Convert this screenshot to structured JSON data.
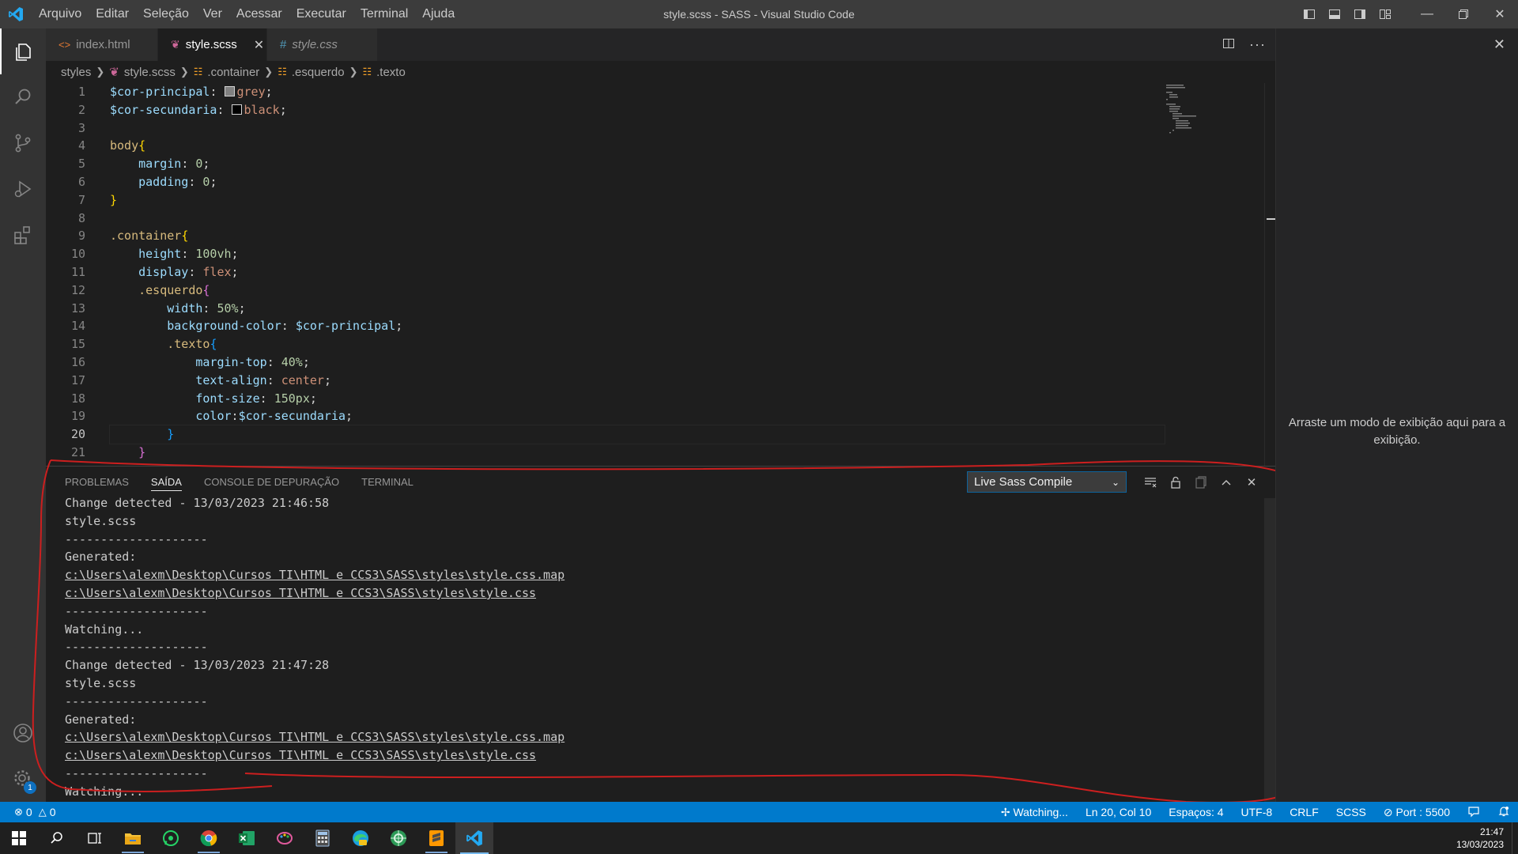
{
  "window": {
    "title": "style.scss - SASS - Visual Studio Code",
    "menu": [
      "Arquivo",
      "Editar",
      "Seleção",
      "Ver",
      "Acessar",
      "Executar",
      "Terminal",
      "Ajuda"
    ]
  },
  "tabs": [
    {
      "label": "index.html",
      "icon": "html-icon"
    },
    {
      "label": "style.scss",
      "icon": "sass-icon",
      "active": true
    },
    {
      "label": "style.css",
      "icon": "css-hash-icon",
      "italic": true
    }
  ],
  "breadcrumb": [
    "styles",
    "style.scss",
    ".container",
    ".esquerdo",
    ".texto"
  ],
  "editor": {
    "current_line": 20,
    "line_numbers": [
      "1",
      "2",
      "3",
      "4",
      "5",
      "6",
      "7",
      "8",
      "9",
      "10",
      "11",
      "12",
      "13",
      "14",
      "15",
      "16",
      "17",
      "18",
      "19",
      "20",
      "21"
    ],
    "lines": {
      "l1": {
        "var": "$cor-principal",
        "colon": ":",
        "val": "grey",
        "semi": ";",
        "swatch_color": "#808080"
      },
      "l2": {
        "var": "$cor-secundaria",
        "colon": ":",
        "val": "black",
        "semi": ";",
        "swatch_color": "#000000"
      },
      "l4": {
        "sel": "body",
        "brace": "{"
      },
      "l5": {
        "prop": "margin",
        "colon": ": ",
        "num": "0",
        "semi": ";"
      },
      "l6": {
        "prop": "padding",
        "colon": ": ",
        "num": "0",
        "semi": ";"
      },
      "l7": {
        "brace": "}"
      },
      "l9": {
        "sel": ".container",
        "brace": "{"
      },
      "l10": {
        "prop": "height",
        "colon": ": ",
        "num": "100vh",
        "semi": ";"
      },
      "l11": {
        "prop": "display",
        "colon": ": ",
        "val": "flex",
        "semi": ";"
      },
      "l12": {
        "sel": ".esquerdo",
        "brace": "{"
      },
      "l13": {
        "prop": "width",
        "colon": ": ",
        "num": "50%",
        "semi": ";"
      },
      "l14": {
        "prop": "background-color",
        "colon": ": ",
        "var": "$cor-principal",
        "semi": ";"
      },
      "l15": {
        "sel": ".texto",
        "brace": "{"
      },
      "l16": {
        "prop": "margin-top",
        "colon": ": ",
        "num": "40%",
        "semi": ";"
      },
      "l17": {
        "prop": "text-align",
        "colon": ": ",
        "val": "center",
        "semi": ";"
      },
      "l18": {
        "prop": "font-size",
        "colon": ": ",
        "num": "150px",
        "semi": ";"
      },
      "l19": {
        "prop": "color",
        "colon": ":",
        "var": "$cor-secundaria",
        "semi": ";"
      },
      "l20": {
        "brace": "}"
      },
      "l21": {
        "brace": "}"
      }
    }
  },
  "panel": {
    "tabs": [
      "PROBLEMAS",
      "SAÍDA",
      "CONSOLE DE DEPURAÇÃO",
      "TERMINAL"
    ],
    "active_tab": "SAÍDA",
    "output_channel": "Live Sass Compile",
    "output": [
      "Change detected - 13/03/2023 21:46:58",
      "style.scss",
      "--------------------",
      "Generated:",
      "c:\\Users\\alexm\\Desktop\\Cursos TI\\HTML e CCS3\\SASS\\styles\\style.css.map",
      "c:\\Users\\alexm\\Desktop\\Cursos TI\\HTML e CCS3\\SASS\\styles\\style.css",
      "--------------------",
      "Watching...",
      "--------------------",
      "Change detected - 13/03/2023 21:47:28",
      "style.scss",
      "--------------------",
      "Generated:",
      "c:\\Users\\alexm\\Desktop\\Cursos TI\\HTML e CCS3\\SASS\\styles\\style.css.map",
      "c:\\Users\\alexm\\Desktop\\Cursos TI\\HTML e CCS3\\SASS\\styles\\style.css",
      "--------------------",
      "Watching..."
    ]
  },
  "aux_sidebar": {
    "hint": "Arraste um modo de exibição aqui para a exibição."
  },
  "statusbar": {
    "errors": "0",
    "warnings": "0",
    "watching": "Watching...",
    "position": "Ln 20, Col 10",
    "spaces": "Espaços: 4",
    "encoding": "UTF-8",
    "eol": "CRLF",
    "language": "SCSS",
    "port": "Port : 5500"
  },
  "activitybar": {
    "settings_badge": "1"
  },
  "taskbar": {
    "time": "21:47",
    "date": "13/03/2023"
  },
  "colors": {
    "accent": "#007acc",
    "annotation": "#cc1f1f"
  }
}
